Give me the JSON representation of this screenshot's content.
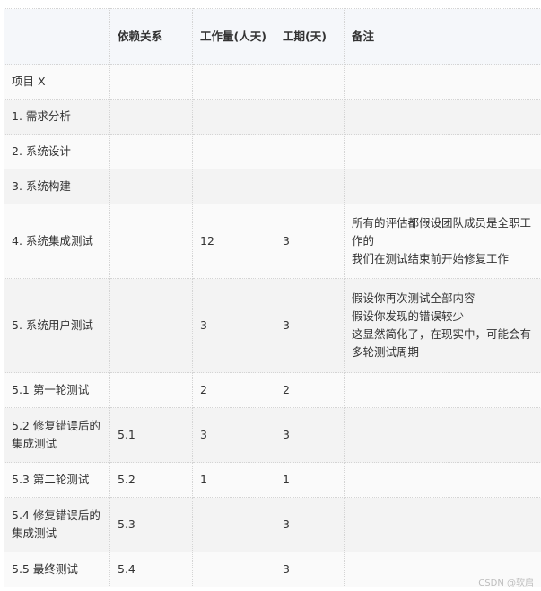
{
  "table": {
    "headers": [
      "",
      "依赖关系",
      "工作量(人天)",
      "工期(天)",
      "备注"
    ],
    "rows": [
      {
        "task": "项目 X",
        "dep": "",
        "effort": "",
        "duration": "",
        "notes": []
      },
      {
        "task": "1. 需求分析",
        "dep": "",
        "effort": "",
        "duration": "",
        "notes": []
      },
      {
        "task": "2. 系统设计",
        "dep": "",
        "effort": "",
        "duration": "",
        "notes": []
      },
      {
        "task": "3. 系统构建",
        "dep": "",
        "effort": "",
        "duration": "",
        "notes": []
      },
      {
        "task": "4. 系统集成测试",
        "dep": "",
        "effort": "12",
        "duration": "3",
        "notes": [
          "所有的评估都假设团队成员是全职工作的",
          "我们在测试结束前开始修复工作"
        ]
      },
      {
        "task": "5. 系统用户测试",
        "dep": "",
        "effort": "3",
        "duration": "3",
        "notes": [
          "假设你再次测试全部内容",
          "假设你发现的错误较少",
          "这显然简化了，在现实中，可能会有多轮测试周期"
        ]
      },
      {
        "task": "5.1 第一轮测试",
        "dep": "",
        "effort": "2",
        "duration": "2",
        "notes": []
      },
      {
        "task": "5.2 修复错误后的集成测试",
        "dep": "5.1",
        "effort": "3",
        "duration": "3",
        "notes": []
      },
      {
        "task": "5.3 第二轮测试",
        "dep": "5.2",
        "effort": "1",
        "duration": "1",
        "notes": []
      },
      {
        "task": "5.4 修复错误后的集成测试",
        "dep": "5.3",
        "effort": "",
        "duration": "3",
        "notes": []
      },
      {
        "task": "5.5 最终测试",
        "dep": "5.4",
        "effort": "",
        "duration": "3",
        "notes": []
      }
    ]
  },
  "watermark": "CSDN @软启"
}
